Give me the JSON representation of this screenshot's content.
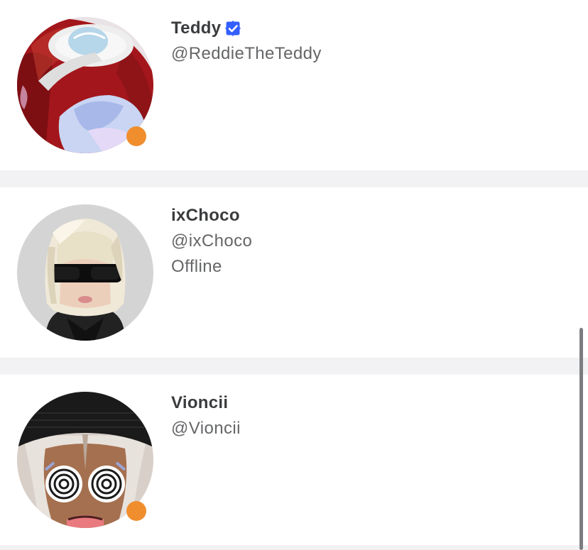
{
  "friends": [
    {
      "display_name": "Teddy",
      "username": "@ReddieTheTeddy",
      "status": "",
      "verified": true,
      "presence": "online",
      "presence_color": "#f08e2e",
      "avatar_icon": "avatar-red-hair-goggles"
    },
    {
      "display_name": "ixChoco",
      "username": "@ixChoco",
      "status": "Offline",
      "verified": false,
      "presence": "offline",
      "avatar_icon": "avatar-blonde-sunglasses"
    },
    {
      "display_name": "Vioncii",
      "username": "@Vioncii",
      "status": "",
      "verified": false,
      "presence": "online",
      "presence_color": "#f08e2e",
      "avatar_icon": "avatar-black-beanie-swirl-eyes"
    }
  ],
  "colors": {
    "verified_badge": "#335fff",
    "background": "#f2f2f4",
    "card": "#ffffff",
    "name_text": "#393b3d",
    "secondary_text": "#656668"
  }
}
